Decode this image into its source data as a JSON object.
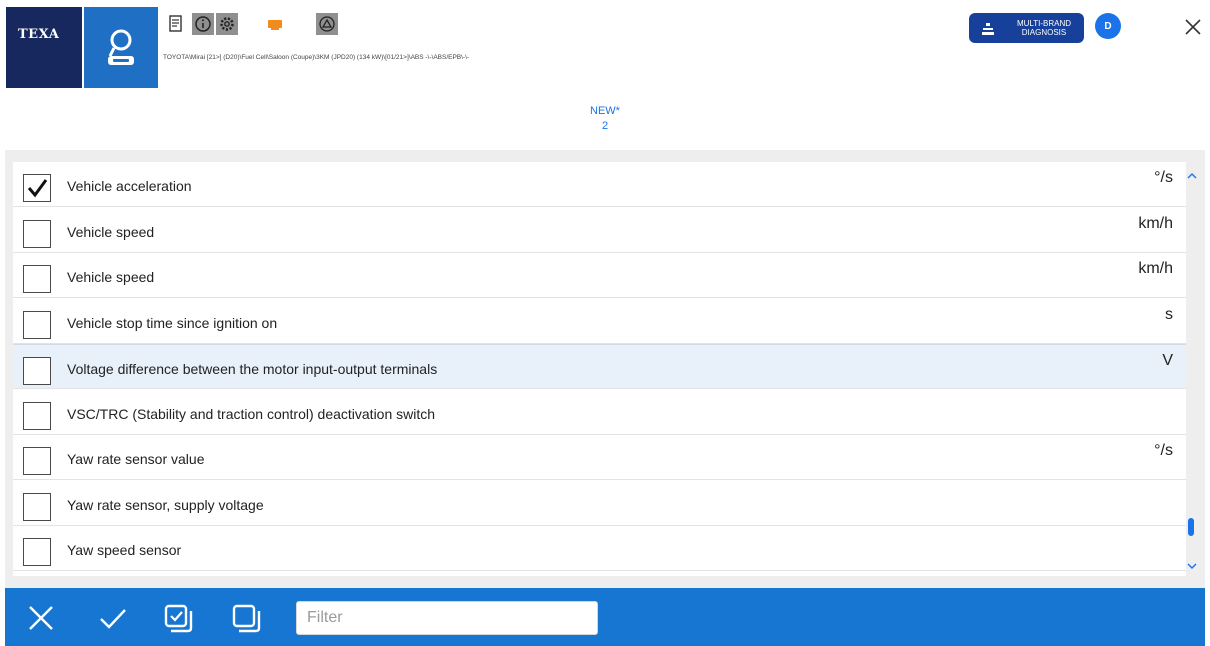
{
  "header": {
    "logo_text": "TEXA",
    "vehicle_path": "TOYOTA\\Mirai [21>] (D20)\\Fuel Cell\\Saloon (Coupe)\\3KM (JPD20) (134 kW)\\[01/21>]\\ABS -\\-\\ABS/EPB\\-\\-",
    "multibrand_label": "MULTI-BRAND DIAGNOSIS",
    "avatar_initial": "D",
    "section_title": "NEW*",
    "section_count": "2",
    "toolbar_icons": [
      "report-icon",
      "info-icon",
      "settings-icon",
      "vehicle-alert-icon",
      "triangle-icon"
    ]
  },
  "parameters": [
    {
      "label": "Vehicle acceleration",
      "unit": "°/s",
      "checked": true
    },
    {
      "label": "Vehicle speed",
      "unit": "km/h",
      "checked": false
    },
    {
      "label": "Vehicle speed",
      "unit": "km/h",
      "checked": false
    },
    {
      "label": "Vehicle stop time since ignition on",
      "unit": "s",
      "checked": false
    },
    {
      "label": "Voltage difference between the motor input-output terminals",
      "unit": "V",
      "checked": false,
      "highlighted": true
    },
    {
      "label": "VSC/TRC (Stability and traction control) deactivation switch",
      "unit": "",
      "checked": false
    },
    {
      "label": "Yaw rate sensor value",
      "unit": "°/s",
      "checked": false
    },
    {
      "label": "Yaw rate sensor, supply voltage",
      "unit": "",
      "checked": false
    },
    {
      "label": "Yaw speed sensor",
      "unit": "",
      "checked": false
    }
  ],
  "bottom_bar": {
    "filter_placeholder": "Filter",
    "icons": [
      "cancel-icon",
      "confirm-icon",
      "select-all-icon",
      "deselect-all-icon"
    ]
  },
  "colors": {
    "brand_dark": "#16285e",
    "brand_blue": "#1f6fc4",
    "accent": "#1a73e8",
    "bottom_bar": "#1676d2",
    "selected_row": "#e8f1fa"
  }
}
